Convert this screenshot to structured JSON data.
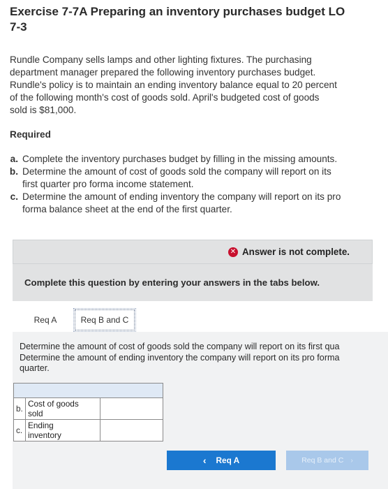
{
  "exercise": {
    "title_line1": "Exercise 7-7A Preparing an inventory purchases budget LO",
    "title_line2": "7-3",
    "intro_lines": [
      "Rundle Company sells lamps and other lighting fixtures. The purchasing",
      "department manager prepared the following inventory purchases budget.",
      "Rundle's policy is to maintain an ending inventory balance equal to 20 percent",
      "of the following month's cost of goods sold. April's budgeted cost of goods",
      "sold is $81,000."
    ],
    "required_label": "Required",
    "requirements": [
      {
        "letter": "a.",
        "lines": [
          "Complete the inventory purchases budget by filling in the missing amounts."
        ]
      },
      {
        "letter": "b.",
        "lines": [
          "Determine the amount of cost of goods sold the company will report on its",
          "first quarter pro forma income statement."
        ]
      },
      {
        "letter": "c.",
        "lines": [
          "Determine the amount of ending inventory the company will report on its pro",
          "forma balance sheet at the end of the first quarter."
        ]
      }
    ]
  },
  "status": {
    "icon": "x-circle-icon",
    "text": "Answer is not complete.",
    "icon_color": "#c8102e"
  },
  "instructions_box": {
    "text": "Complete this question by entering your answers in the tabs below."
  },
  "tabs": [
    {
      "label": "Req A",
      "active": false
    },
    {
      "label": "Req B and C",
      "active": true
    }
  ],
  "panel": {
    "instruction_lines": [
      "Determine the amount of cost of goods sold the company will report on its first qua",
      "Determine the amount of ending inventory the company will report on its pro forma",
      "quarter."
    ]
  },
  "answer_table": {
    "rows": [
      {
        "letter": "b.",
        "label_lines": [
          "Cost of goods",
          "sold"
        ],
        "value": ""
      },
      {
        "letter": "c.",
        "label_lines": [
          "Ending",
          "inventory"
        ],
        "value": ""
      }
    ]
  },
  "navigation": {
    "prev_label": "Req A",
    "next_label": "Req B and C",
    "prev_color": "#1b78d0"
  }
}
